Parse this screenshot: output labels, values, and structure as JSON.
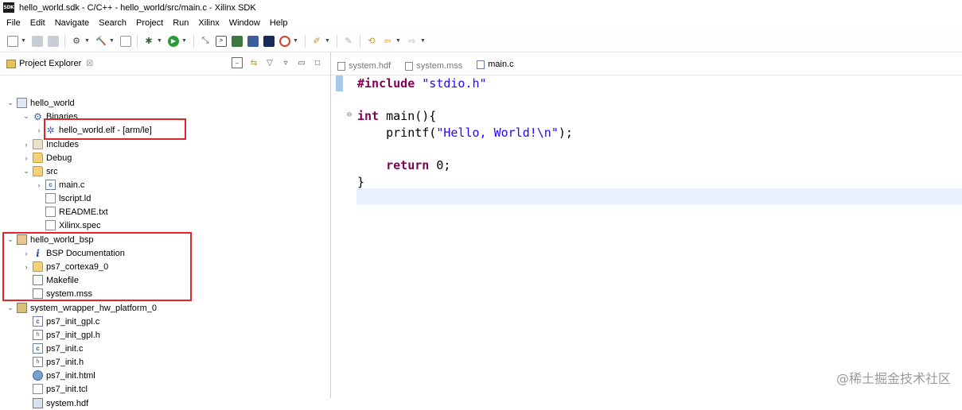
{
  "window": {
    "title": "hello_world.sdk - C/C++ - hello_world/src/main.c - Xilinx SDK",
    "app_icon_text": "SDK"
  },
  "menu": [
    "File",
    "Edit",
    "Navigate",
    "Search",
    "Project",
    "Run",
    "Xilinx",
    "Window",
    "Help"
  ],
  "project_explorer": {
    "title": "Project Explorer",
    "close": "☒",
    "tree": [
      {
        "label": "hello_world",
        "icon": "project-icon",
        "arrow": "expanded"
      },
      {
        "label": "Binaries",
        "icon": "binaries-icon",
        "arrow": "expanded"
      },
      {
        "label": "hello_world.elf - [arm/le]",
        "icon": "elf-gear-icon",
        "arrow": "collapsed"
      },
      {
        "label": "Includes",
        "icon": "includes-icon",
        "arrow": "collapsed"
      },
      {
        "label": "Debug",
        "icon": "folder-icon",
        "arrow": "collapsed"
      },
      {
        "label": "src",
        "icon": "folder-icon",
        "arrow": "expanded"
      },
      {
        "label": "main.c",
        "icon": "c-file-icon",
        "arrow": "collapsed"
      },
      {
        "label": "lscript.ld",
        "icon": "file-icon",
        "arrow": "none"
      },
      {
        "label": "README.txt",
        "icon": "file-icon",
        "arrow": "none"
      },
      {
        "label": "Xilinx.spec",
        "icon": "file-icon",
        "arrow": "none"
      },
      {
        "label": "hello_world_bsp",
        "icon": "bsp-project-icon",
        "arrow": "expanded"
      },
      {
        "label": "BSP Documentation",
        "icon": "info-icon",
        "arrow": "collapsed"
      },
      {
        "label": "ps7_cortexa9_0",
        "icon": "folder-icon",
        "arrow": "collapsed"
      },
      {
        "label": "Makefile",
        "icon": "makefile-icon",
        "arrow": "none"
      },
      {
        "label": "system.mss",
        "icon": "mss-file-icon",
        "arrow": "none"
      },
      {
        "label": "system_wrapper_hw_platform_0",
        "icon": "hw-platform-icon",
        "arrow": "expanded"
      },
      {
        "label": "ps7_init_gpl.c",
        "icon": "c-file-icon",
        "arrow": "none"
      },
      {
        "label": "ps7_init_gpl.h",
        "icon": "h-file-icon",
        "arrow": "none"
      },
      {
        "label": "ps7_init.c",
        "icon": "c-file-icon",
        "arrow": "none"
      },
      {
        "label": "ps7_init.h",
        "icon": "h-file-icon",
        "arrow": "none"
      },
      {
        "label": "ps7_init.html",
        "icon": "html-globe-icon",
        "arrow": "none"
      },
      {
        "label": "ps7_init.tcl",
        "icon": "file-icon",
        "arrow": "none"
      },
      {
        "label": "system.hdf",
        "icon": "hdf-file-icon",
        "arrow": "none"
      }
    ]
  },
  "editor": {
    "tabs": [
      {
        "label": "system.hdf",
        "active": false
      },
      {
        "label": "system.mss",
        "active": false
      },
      {
        "label": "main.c",
        "active": true
      }
    ],
    "code": {
      "include_kw": "#include",
      "include_str": "\"stdio.h\"",
      "int_kw": "int",
      "main_sig": " main(){",
      "printf_call": "printf(",
      "printf_str": "\"Hello, World!\\n\"",
      "printf_end": ");",
      "return_kw": "return",
      "return_val": " 0;",
      "close_brace": "}"
    }
  },
  "watermark": "@稀土掘金技术社区",
  "colors": {
    "highlight": "#e0262a",
    "keyword": "#7f0055",
    "string": "#2a00ff",
    "current_line": "#e8f2fe"
  }
}
